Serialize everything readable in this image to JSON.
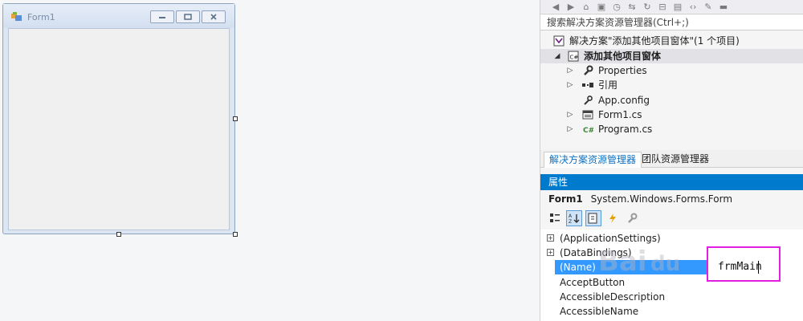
{
  "designer": {
    "form_title": "Form1"
  },
  "solution_explorer": {
    "search_placeholder": "搜索解决方案资源管理器(Ctrl+;)",
    "tree": [
      {
        "label": "解决方案\"添加其他项目窗体\"(1 个项目)",
        "icon": "solution-icon"
      },
      {
        "label": "添加其他项目窗体",
        "icon": "csharp-project-icon",
        "selected": true
      },
      {
        "label": "Properties",
        "icon": "wrench-icon"
      },
      {
        "label": "引用",
        "icon": "references-icon"
      },
      {
        "label": "App.config",
        "icon": "config-file-icon"
      },
      {
        "label": "Form1.cs",
        "icon": "form-file-icon"
      },
      {
        "label": "Program.cs",
        "icon": "csharp-file-icon"
      }
    ],
    "tabs": [
      "解决方案资源管理器",
      "团队资源管理器"
    ]
  },
  "properties": {
    "header": "属性",
    "object_name": "Form1",
    "object_type": "System.Windows.Forms.Form",
    "rows": [
      {
        "name": "(ApplicationSettings)",
        "category": true
      },
      {
        "name": "(DataBindings)",
        "category": true
      },
      {
        "name": "(Name)",
        "selected": true
      },
      {
        "name": "AcceptButton"
      },
      {
        "name": "AccessibleDescription"
      },
      {
        "name": "AccessibleName"
      }
    ],
    "name_value": "frmMain"
  },
  "watermark": {
    "text": "Bai du 经验"
  },
  "colors": {
    "accent": "#007acc",
    "selection": "#3399ff",
    "highlight_box": "#e020e0"
  }
}
